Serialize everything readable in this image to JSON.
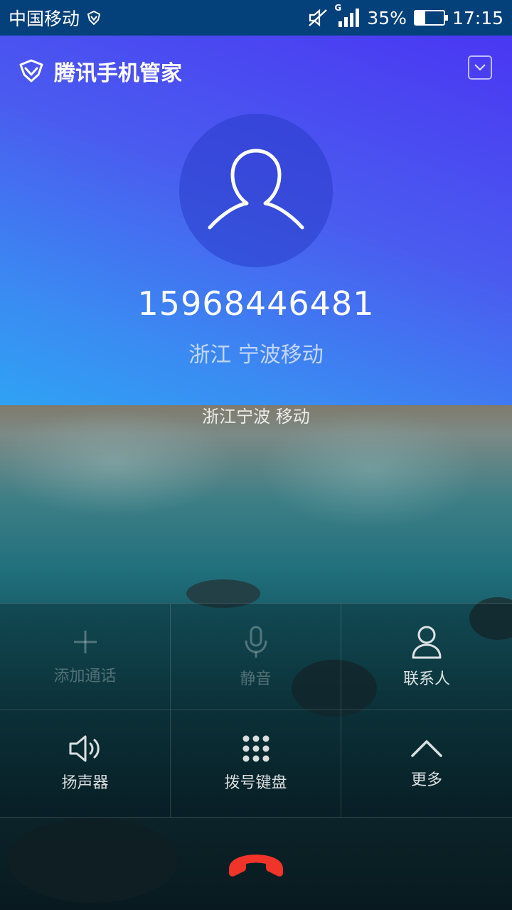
{
  "status_bar": {
    "carrier": "中国移动",
    "network_type": "G",
    "battery": "35%",
    "battery_level": 0.35,
    "time": "17:15"
  },
  "security_popup": {
    "app_name": "腾讯手机管家",
    "caller_number": "15968446481",
    "caller_location": "浙江 宁波移动"
  },
  "call_screen": {
    "caller_location": "浙江宁波 移动",
    "controls": [
      {
        "label": "添加通话",
        "icon": "plus-icon",
        "enabled": false
      },
      {
        "label": "静音",
        "icon": "microphone-icon",
        "enabled": false
      },
      {
        "label": "联系人",
        "icon": "contact-icon",
        "enabled": true
      },
      {
        "label": "扬声器",
        "icon": "speaker-icon",
        "enabled": true
      },
      {
        "label": "拨号键盘",
        "icon": "dialpad-icon",
        "enabled": true
      },
      {
        "label": "更多",
        "icon": "chevron-up-icon",
        "enabled": true
      }
    ],
    "end_call_icon": "hangup-icon",
    "end_call_color": "#f0342a"
  },
  "colors": {
    "status_bar_bg": "#04407a",
    "popup_gradient_start": "#4a37f2",
    "popup_gradient_end": "#2fa2f4"
  }
}
